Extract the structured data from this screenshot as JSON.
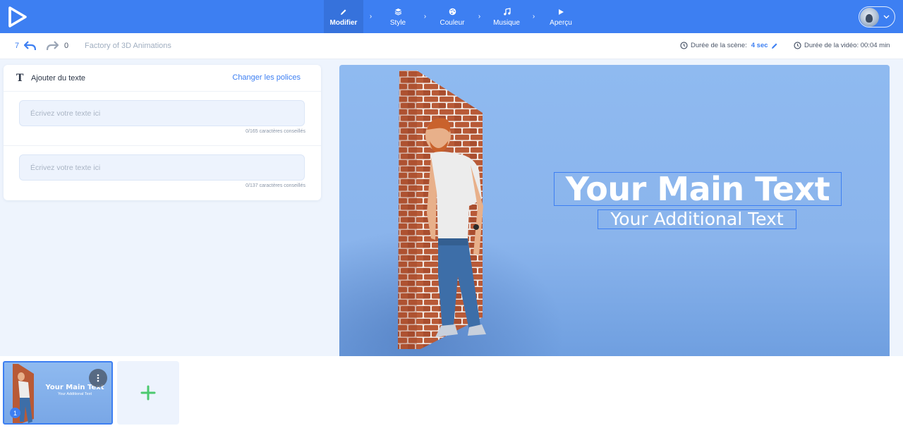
{
  "nav": {
    "steps": [
      {
        "label": "Modifier",
        "active": true
      },
      {
        "label": "Style"
      },
      {
        "label": "Couleur"
      },
      {
        "label": "Musique"
      },
      {
        "label": "Aperçu"
      }
    ],
    "separator": "›"
  },
  "toolbar": {
    "undo_count": "7",
    "redo_count": "0",
    "project_name": "Factory of 3D Animations",
    "scene_duration_label": "Durée de la scène:",
    "scene_duration_value": "4 sec",
    "video_duration": "Durée de la vidéo: 00:04 min"
  },
  "text_panel": {
    "title": "Ajouter du texte",
    "change_fonts": "Changer les polices",
    "fields": [
      {
        "placeholder": "Écrivez votre texte ici",
        "value": "",
        "hint": "0/165 caractères conseillés"
      },
      {
        "placeholder": "Écrivez votre texte ici",
        "value": "",
        "hint": "0/137 caractères conseillés"
      }
    ]
  },
  "preview": {
    "main_text": "Your Main Text",
    "additional_text": "Your Additional Text"
  },
  "timeline": {
    "scenes": [
      {
        "number": "1",
        "main_text": "Your Main Text",
        "sub_text": "Your Additional Text"
      }
    ]
  },
  "colors": {
    "primary": "#3d7ff2",
    "preview_bg": "#8fbaf0",
    "add_icon": "#4cc96e"
  }
}
